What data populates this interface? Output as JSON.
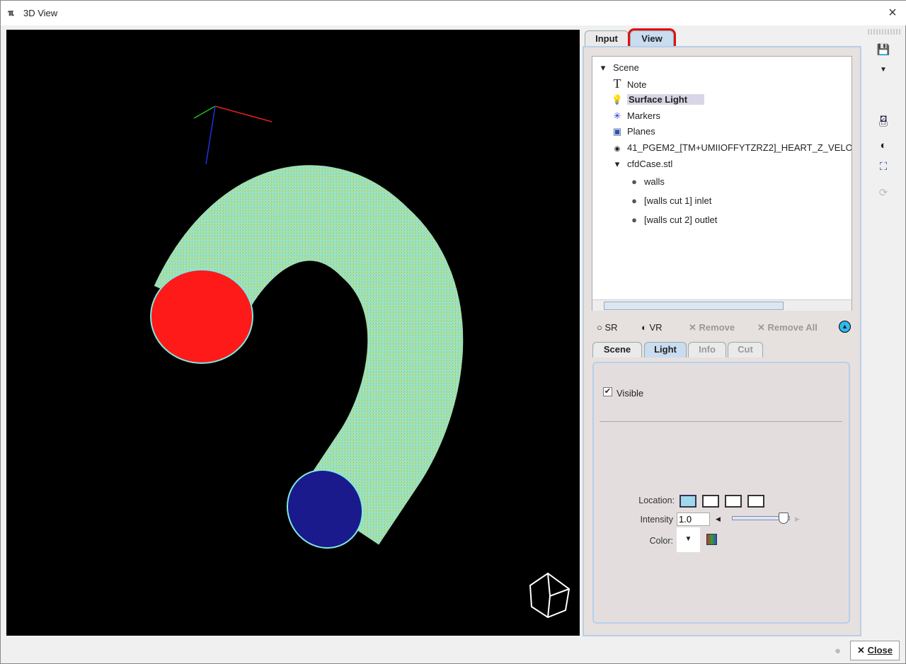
{
  "window": {
    "title": "3D View",
    "icon": "pmod-icon",
    "close_icon": "×"
  },
  "tabs": [
    {
      "label": "Input",
      "active": false
    },
    {
      "label": "View",
      "active": true,
      "highlighted": true
    }
  ],
  "tree": {
    "items": [
      {
        "label": "Scene",
        "icon": "triangle-down"
      },
      {
        "label": "Note",
        "icon": "text-T"
      },
      {
        "label": "Surface Light",
        "icon": "lightbulb",
        "selected": true
      },
      {
        "label": "Markers",
        "icon": "markers"
      },
      {
        "label": "Planes",
        "icon": "cube"
      },
      {
        "label": "41_PGEM2_[TM+UMIIOFFYTZRZ2]_HEART_Z_VELOC",
        "icon": "target"
      },
      {
        "label": "cfdCase.stl",
        "icon": "triangle-down"
      },
      {
        "label": "walls",
        "icon": "sphere"
      },
      {
        "label": "[walls cut 1] inlet",
        "icon": "sphere"
      },
      {
        "label": "[walls cut 2] outlet",
        "icon": "sphere"
      }
    ]
  },
  "toolbar": {
    "sr": "SR",
    "vr": "VR",
    "remove": "Remove",
    "remove_all": "Remove All"
  },
  "subtabs": [
    {
      "label": "Scene"
    },
    {
      "label": "Light",
      "active": true
    },
    {
      "label": "Info",
      "disabled": true
    },
    {
      "label": "Cut",
      "disabled": true
    }
  ],
  "light": {
    "visible_label": "Visible",
    "visible_checked": true,
    "location_label": "Location:",
    "location_selected": "top-left",
    "intensity_label": "Intensity",
    "intensity_value": "1.0",
    "intensity_slider_fraction": 0.88,
    "color_label": "Color:"
  },
  "footer": {
    "close_label": "Close"
  },
  "colors": {
    "inlet": "#ff1a1a",
    "outlet": "#1a1a8c",
    "tube": "#7fe8e0",
    "accent": "#c9dcf0",
    "highlight": "#e01010"
  }
}
